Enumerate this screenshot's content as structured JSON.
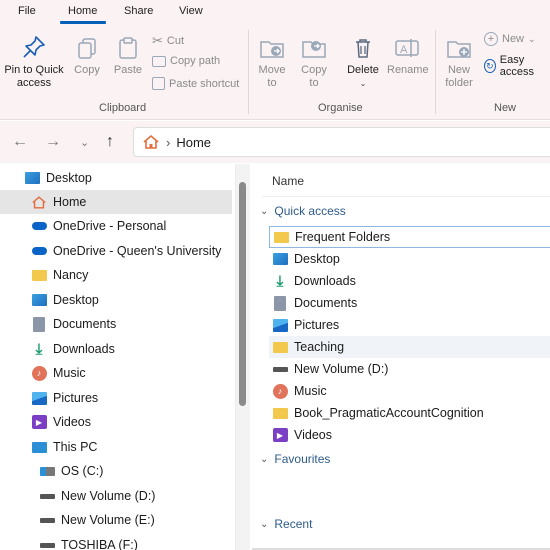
{
  "menu": {
    "tabs": [
      "File",
      "Home",
      "Share",
      "View"
    ],
    "active": "Home"
  },
  "ribbon": {
    "clipboard": {
      "pin_label": "Pin to Quick access",
      "copy_label": "Copy",
      "paste_label": "Paste",
      "cut_label": "Cut",
      "copy_path_label": "Copy path",
      "paste_shortcut_label": "Paste shortcut",
      "group_label": "Clipboard"
    },
    "organise": {
      "move_to_label": "Move to",
      "copy_to_label": "Copy to",
      "delete_label": "Delete",
      "rename_label": "Rename",
      "group_label": "Organise"
    },
    "new": {
      "new_folder_label": "New folder",
      "new_item_label": "New",
      "easy_access_label": "Easy access",
      "group_label": "New"
    }
  },
  "address": {
    "location": "Home",
    "separator": "›"
  },
  "sidebar": {
    "items": [
      {
        "label": "Desktop",
        "icon": "desktop-icon"
      },
      {
        "label": "Home",
        "icon": "home-icon"
      },
      {
        "label": "OneDrive - Personal",
        "icon": "onedrive-icon"
      },
      {
        "label": "OneDrive - Queen's University",
        "icon": "onedrive-icon"
      },
      {
        "label": "Nancy",
        "icon": "folder-icon"
      },
      {
        "label": "Desktop",
        "icon": "desktop-icon"
      },
      {
        "label": "Documents",
        "icon": "documents-icon"
      },
      {
        "label": "Downloads",
        "icon": "downloads-icon"
      },
      {
        "label": "Music",
        "icon": "music-icon"
      },
      {
        "label": "Pictures",
        "icon": "pictures-icon"
      },
      {
        "label": "Videos",
        "icon": "videos-icon"
      },
      {
        "label": "This PC",
        "icon": "pc-icon"
      },
      {
        "label": "OS (C:)",
        "icon": "os-drive-icon"
      },
      {
        "label": "New Volume (D:)",
        "icon": "drive-icon"
      },
      {
        "label": "New Volume (E:)",
        "icon": "drive-icon"
      },
      {
        "label": "TOSHIBA (F:)",
        "icon": "drive-icon"
      }
    ],
    "selected": "Home"
  },
  "main": {
    "column_name": "Name",
    "quick_access": {
      "title": "Quick access",
      "items": [
        {
          "label": "Frequent Folders",
          "icon": "folder-icon"
        },
        {
          "label": "Desktop",
          "icon": "desktop-icon"
        },
        {
          "label": "Downloads",
          "icon": "downloads-icon"
        },
        {
          "label": "Documents",
          "icon": "documents-icon"
        },
        {
          "label": "Pictures",
          "icon": "pictures-icon"
        },
        {
          "label": "Teaching",
          "icon": "folder-icon"
        },
        {
          "label": "New Volume (D:)",
          "icon": "drive-icon"
        },
        {
          "label": "Music",
          "icon": "music-icon"
        },
        {
          "label": "Book_PragmaticAccountCognition",
          "icon": "folder-icon"
        },
        {
          "label": "Videos",
          "icon": "videos-icon"
        }
      ]
    },
    "favourites": {
      "title": "Favourites"
    },
    "recent": {
      "title": "Recent"
    }
  },
  "colors": {
    "accent": "#005fb8",
    "folder": "#f2c94c",
    "ribbon_bg": "#fbf3f3"
  }
}
